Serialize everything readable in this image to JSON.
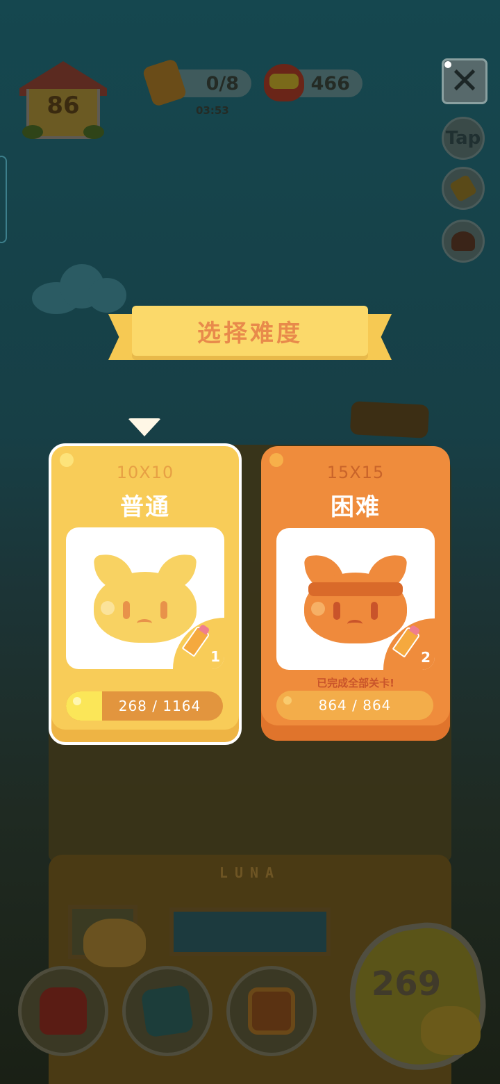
{
  "hud": {
    "house_level": "86",
    "pencil_count": "0/8",
    "timer": "03:53",
    "can_count": "466",
    "tap_label": "Tap",
    "close_symbol": "✕"
  },
  "dialog": {
    "title": "选择难度",
    "cards": [
      {
        "size": "10X10",
        "level": "普通",
        "pencil_count": "1",
        "progress_text": "268 / 1164",
        "progress_fraction": 0.23,
        "complete_text": ""
      },
      {
        "size": "15X15",
        "level": "困难",
        "pencil_count": "2",
        "progress_text": "864 / 864",
        "progress_fraction": 1.0,
        "complete_text": "已完成全部关卡!"
      }
    ]
  },
  "scene": {
    "shop_sign": "LUNA",
    "coin_count": "269"
  },
  "icons": {
    "side": [
      "tap-icon",
      "brush-icon",
      "stamp-icon"
    ],
    "bottom": [
      "sofa-icon",
      "album-icon",
      "picture-frame-icon"
    ]
  },
  "colors": {
    "normal_card": "#f8cc58",
    "hard_card": "#ef8c3c",
    "banner": "#fbd96a",
    "banner_text": "#e88a4b"
  }
}
